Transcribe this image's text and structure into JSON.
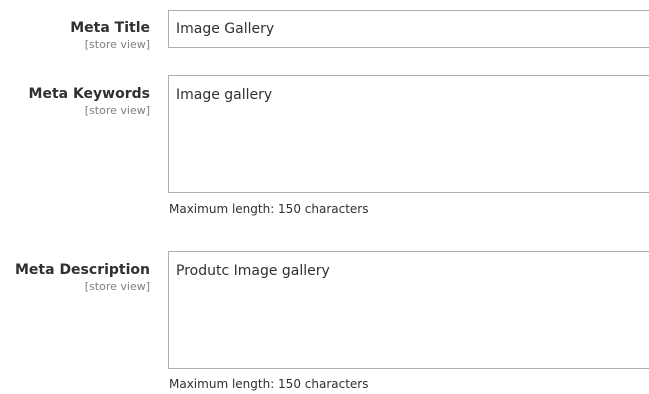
{
  "fields": {
    "meta_title": {
      "label": "Meta Title",
      "scope": "[store view]",
      "value": "Image Gallery"
    },
    "meta_keywords": {
      "label": "Meta Keywords",
      "scope": "[store view]",
      "value": "Image gallery",
      "note": "Maximum length: 150 characters"
    },
    "meta_description": {
      "label": "Meta Description",
      "scope": "[store view]",
      "value": "Produtc Image gallery",
      "note": "Maximum length: 150 characters"
    }
  }
}
